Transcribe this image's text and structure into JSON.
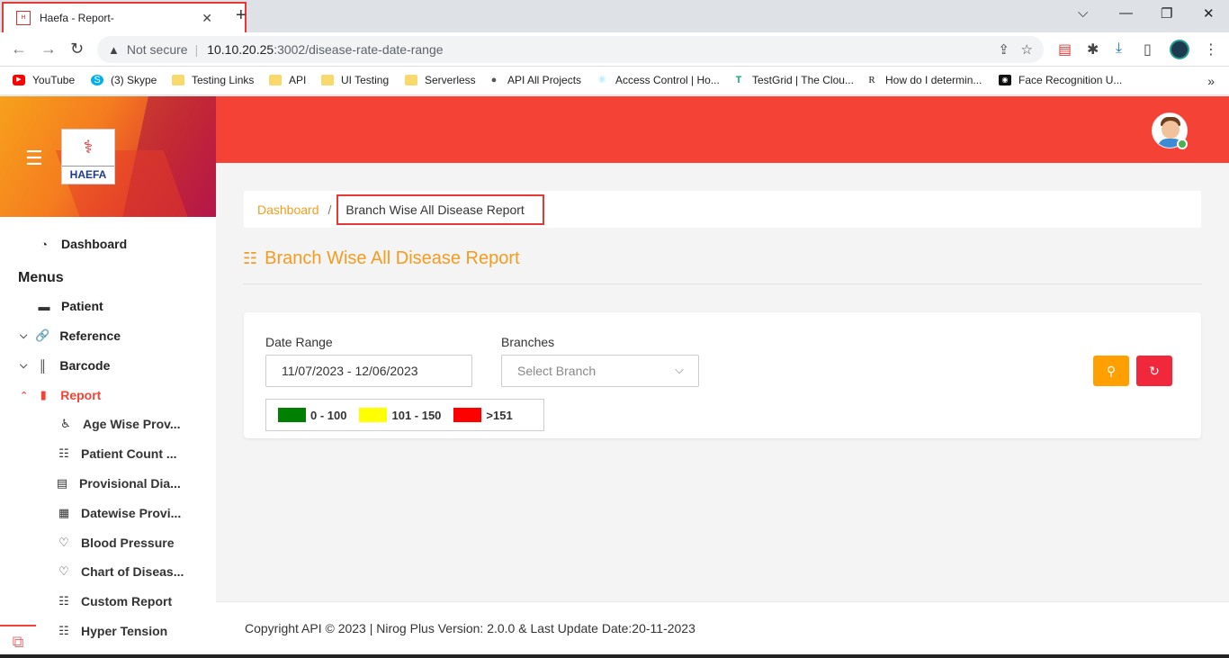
{
  "browser": {
    "tab_title": "Haefa - Report-",
    "tab_close": "✕",
    "new_tab": "+",
    "window_controls": [
      "⌵",
      "—",
      "❐",
      "✕"
    ],
    "security_label": "Not secure",
    "url_host": "10.10.20.25",
    "url_path": ":3002/disease-rate-date-range",
    "bookmarks": [
      {
        "label": "YouTube",
        "icon": "youtube-icon"
      },
      {
        "label": "(3) Skype",
        "icon": "skype-icon"
      },
      {
        "label": "Testing Links",
        "icon": "folder-icon"
      },
      {
        "label": "API",
        "icon": "folder-icon"
      },
      {
        "label": "UI Testing",
        "icon": "folder-icon"
      },
      {
        "label": "Serverless",
        "icon": "folder-icon"
      },
      {
        "label": "API All Projects",
        "icon": "globe-icon"
      },
      {
        "label": "Access Control | Ho...",
        "icon": "react-icon"
      },
      {
        "label": "TestGrid | The Clou...",
        "icon": "testgrid-icon"
      },
      {
        "label": "How do I determin...",
        "icon": "r-icon"
      },
      {
        "label": "Face Recognition U...",
        "icon": "camera-icon"
      }
    ],
    "bookmarks_more": "»"
  },
  "brand": {
    "logo_text": "HAEFA"
  },
  "sidebar": {
    "dashboard": "Dashboard",
    "menus_heading": "Menus",
    "patient": "Patient",
    "reference": "Reference",
    "barcode": "Barcode",
    "report": "Report",
    "report_items": [
      "Age Wise Prov...",
      "Patient Count ...",
      "Provisional Dia...",
      "Datewise Provi...",
      "Blood Pressure",
      "Chart of Diseas...",
      "Custom Report",
      "Hyper Tension"
    ]
  },
  "breadcrumb": {
    "home": "Dashboard",
    "separator": "/",
    "current": "Branch Wise All Disease Report"
  },
  "page": {
    "title": "Branch Wise All Disease Report"
  },
  "filters": {
    "date_range_label": "Date Range",
    "date_range_value": "11/07/2023 - 12/06/2023",
    "branches_label": "Branches",
    "branches_placeholder": "Select Branch"
  },
  "legend": [
    {
      "label": "0 - 100",
      "color": "#008000"
    },
    {
      "label": "101 - 150",
      "color": "#ffff00"
    },
    {
      "label": ">151",
      "color": "#ff0000"
    }
  ],
  "colors": {
    "accent": "#f44336",
    "title_orange": "#f59b1e",
    "search_button": "#ffa000",
    "refresh_button": "#f1283b"
  },
  "footer": {
    "text": "Copyright API © 2023 | Nirog Plus Version: 2.0.0 & Last Update Date:20-11-2023"
  }
}
